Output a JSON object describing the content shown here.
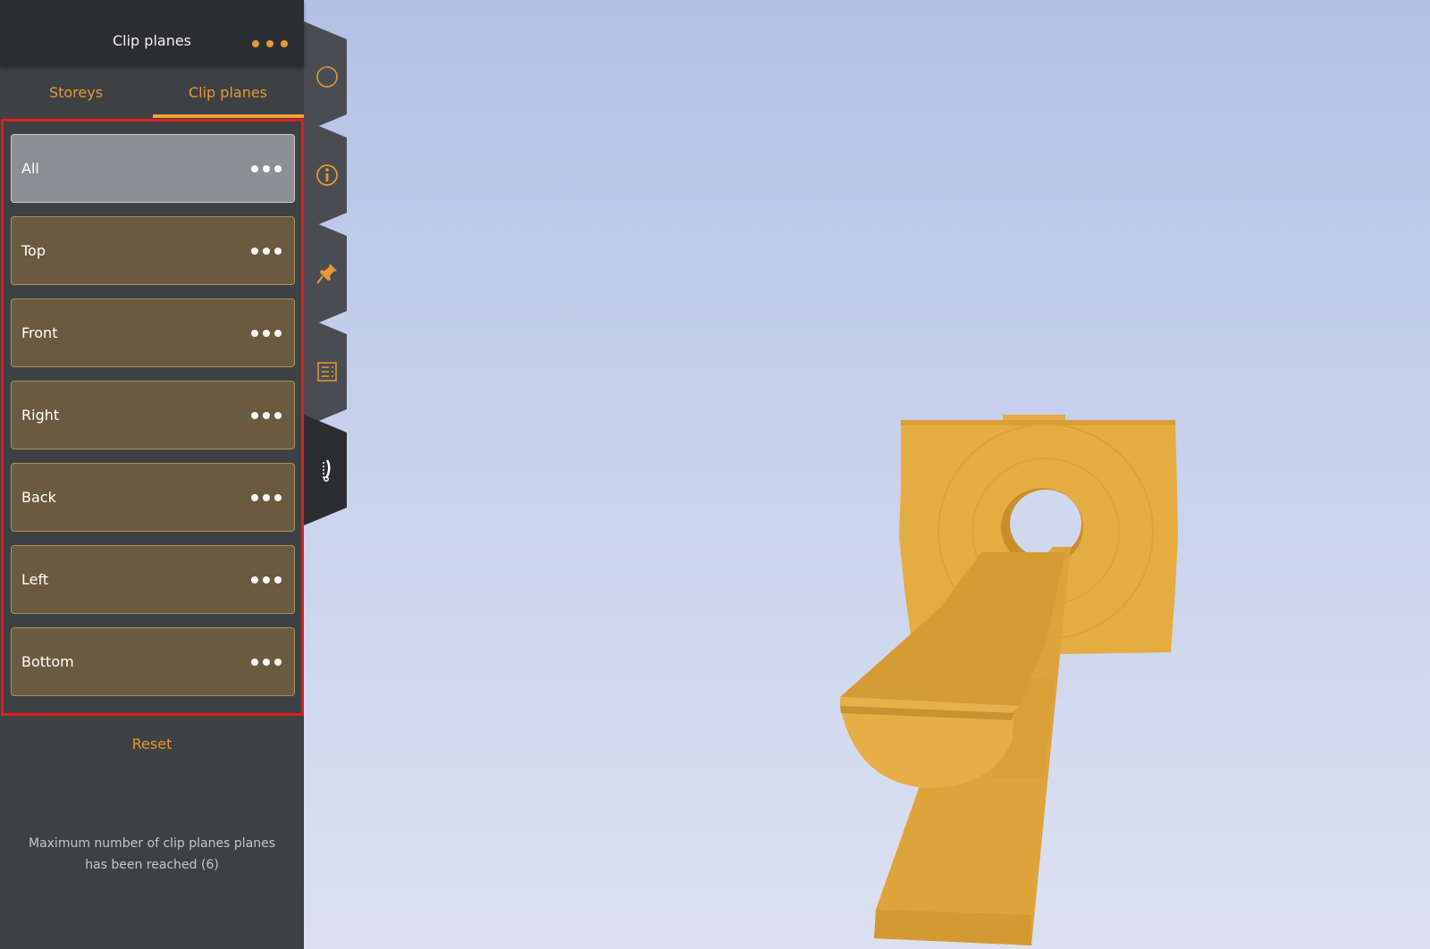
{
  "panel": {
    "title": "Clip planes",
    "more_icon": "more-dots-icon",
    "tabs": [
      {
        "label": "Storeys",
        "active": false
      },
      {
        "label": "Clip planes",
        "active": true
      }
    ],
    "planes": [
      {
        "label": "All",
        "selected": true
      },
      {
        "label": "Top",
        "selected": false
      },
      {
        "label": "Front",
        "selected": false
      },
      {
        "label": "Right",
        "selected": false
      },
      {
        "label": "Back",
        "selected": false
      },
      {
        "label": "Left",
        "selected": false
      },
      {
        "label": "Bottom",
        "selected": false
      }
    ],
    "reset_label": "Reset",
    "limit_message": "Maximum number of clip planes planes has been reached (6)"
  },
  "side_tabs": [
    {
      "icon": "circle-icon",
      "active": false
    },
    {
      "icon": "info-icon",
      "active": false
    },
    {
      "icon": "pin-icon",
      "active": false
    },
    {
      "icon": "list-icon",
      "active": false
    },
    {
      "icon": "clip-plane-icon",
      "active": true
    }
  ],
  "colors": {
    "accent": "#e39a34",
    "panel_bg": "#3e4044",
    "header_bg": "#2c2d30",
    "plane_bg": "#6a5a3f",
    "selected_bg": "#8c8f93",
    "highlight_border": "#e11d1d",
    "model": "#e3ab40",
    "viewport_top": "#b3c1e6",
    "viewport_bottom": "#dbe1f1"
  }
}
